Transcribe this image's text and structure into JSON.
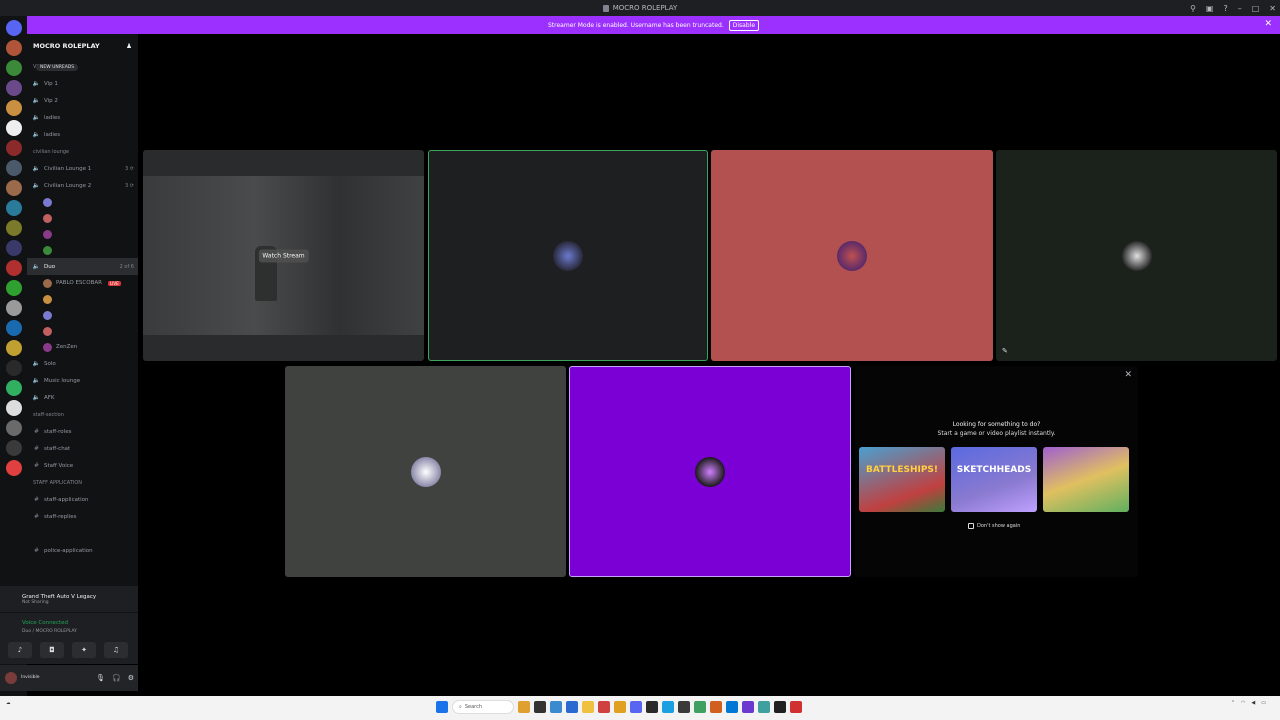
{
  "window": {
    "title": "MOCRO ROLEPLAY"
  },
  "banner": {
    "text": "Streamer Mode is enabled. Username has been truncated.",
    "disable_label": "Disable"
  },
  "server": {
    "name": "MOCRO ROLEPLAY",
    "new_unreads": "NEW UNREADS"
  },
  "channels": [
    {
      "kind": "cat",
      "label": "VIP"
    },
    {
      "kind": "voice",
      "label": "Vip 1",
      "locked": true
    },
    {
      "kind": "voice",
      "label": "Vip 2",
      "locked": true
    },
    {
      "kind": "voice",
      "label": "ladies",
      "locked": true
    },
    {
      "kind": "voice",
      "label": "ladies",
      "locked": true
    },
    {
      "kind": "cat",
      "label": "civilian lounge"
    },
    {
      "kind": "voice",
      "label": "Civilian Lounge 1",
      "right": "3 ⟳"
    },
    {
      "kind": "voice",
      "label": "Civilian Lounge 2",
      "right": "3 ⟳"
    },
    {
      "kind": "user",
      "label": "",
      "right": ""
    },
    {
      "kind": "user",
      "label": "",
      "right": ""
    },
    {
      "kind": "user",
      "label": "",
      "right": ""
    },
    {
      "kind": "user",
      "label": "",
      "right": ""
    },
    {
      "kind": "voice-active",
      "label": "Duo",
      "right": "2 of 6"
    },
    {
      "kind": "user",
      "label": "PABLO ESCOBAR",
      "live": "LIVE"
    },
    {
      "kind": "user",
      "label": "",
      "right": ""
    },
    {
      "kind": "user",
      "label": "",
      "right": ""
    },
    {
      "kind": "user",
      "label": "",
      "right": ""
    },
    {
      "kind": "user",
      "label": "ZenZen",
      "right": ""
    },
    {
      "kind": "voice",
      "label": "Solo",
      "right": ""
    },
    {
      "kind": "voice",
      "label": "Music lounge",
      "right": ""
    },
    {
      "kind": "voice",
      "label": "AFK",
      "right": ""
    },
    {
      "kind": "cat",
      "label": "staff-section"
    },
    {
      "kind": "text",
      "label": "staff-roles"
    },
    {
      "kind": "text",
      "label": "staff-chat"
    },
    {
      "kind": "text",
      "label": "Staff Voice"
    },
    {
      "kind": "cat",
      "label": "STAFF APPLICATION"
    },
    {
      "kind": "text",
      "label": "staff-application"
    },
    {
      "kind": "text",
      "label": "staff-replies"
    },
    {
      "kind": "cat",
      "label": ""
    },
    {
      "kind": "text",
      "label": "police-application"
    }
  ],
  "activity": {
    "title": "Grand Theft Auto V Legacy",
    "sub": "Not Sharing"
  },
  "voice": {
    "status": "Voice Connected",
    "sub": "Duo / MOCRO ROLEPLAY"
  },
  "user": {
    "name": "",
    "status": "Invisible"
  },
  "tiles": {
    "watch_stream_label": "Watch Stream"
  },
  "suggest": {
    "title": "Looking for something to do?",
    "subtitle": "Start a game or video playlist instantly.",
    "games": [
      "BATTLESHIPS!",
      "SKETCHHEADS",
      ""
    ],
    "dont_show": "Don't show again"
  },
  "taskbar": {
    "search": "Search",
    "clock_time": "",
    "clock_date": ""
  },
  "colors": {
    "accent": "#9b30ff",
    "tile_green_border": "#3ba55d",
    "tile_red": "#b35050",
    "tile_dark_green": "#1b211b",
    "tile_grey": "#3f423f",
    "tile_purple": "#7a00d6"
  }
}
